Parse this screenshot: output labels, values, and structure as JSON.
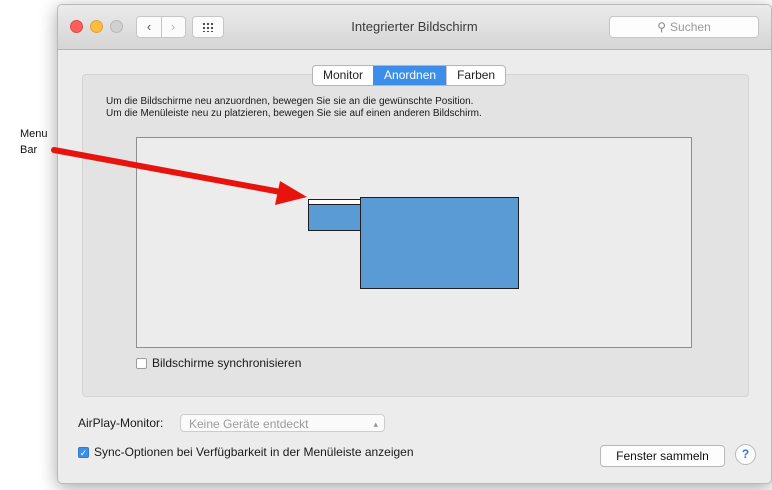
{
  "annotation": {
    "line1": "Menu",
    "line2": "Bar",
    "arrow_color": "#e8130c"
  },
  "titlebar": {
    "title": "Integrierter Bildschirm",
    "back_icon": "chevron-left-icon",
    "forward_icon": "chevron-right-icon",
    "grid_icon": "grid-icon",
    "search": {
      "icon": "magnifier-icon",
      "icon_glyph": "⚲",
      "placeholder": "Suchen"
    }
  },
  "tabs": [
    {
      "label": "Monitor",
      "active": false
    },
    {
      "label": "Anordnen",
      "active": true
    },
    {
      "label": "Farben",
      "active": false
    }
  ],
  "arrange": {
    "instruction_line1": "Um die Bildschirme neu anzuordnen, bewegen Sie sie an die gewünschte Position.",
    "instruction_line2": "Um die Menüleiste neu zu platzieren, bewegen Sie sie auf einen anderen Bildschirm.",
    "display_color": "#5b9bd5",
    "mirror_label": "Bildschirme synchronisieren",
    "mirror_checked": false
  },
  "footer": {
    "airplay_label": "AirPlay-Monitor:",
    "airplay_value": "Keine Geräte entdeckt",
    "sync_label": "Sync-Optionen bei Verfügbarkeit in der Menüleiste anzeigen",
    "sync_checked": true,
    "gather_button": "Fenster sammeln",
    "help": "?"
  },
  "colors": {
    "accent": "#3d8ee8"
  }
}
